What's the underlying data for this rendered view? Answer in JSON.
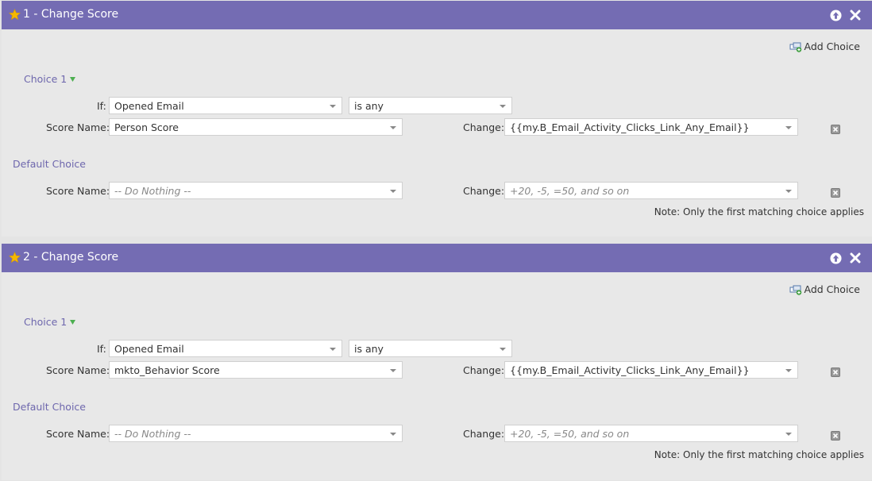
{
  "steps": [
    {
      "title": "1 - Change Score",
      "add_choice": "Add Choice",
      "choice_label": "Choice 1",
      "if_label": "If:",
      "if_value": "Opened Email",
      "operator_value": "is any",
      "score_name_label": "Score Name:",
      "score_name_value": "Person Score",
      "change_label": "Change:",
      "change_value": "{{my.B_Email_Activity_Clicks_Link_Any_Email}}",
      "default_label": "Default Choice",
      "default_score_name_label": "Score Name:",
      "default_score_name_placeholder": "-- Do Nothing --",
      "default_change_label": "Change:",
      "default_change_placeholder": "+20, -5, =50, and so on",
      "note": "Note: Only the first matching choice applies"
    },
    {
      "title": "2 - Change Score",
      "add_choice": "Add Choice",
      "choice_label": "Choice 1",
      "if_label": "If:",
      "if_value": "Opened Email",
      "operator_value": "is any",
      "score_name_label": "Score Name:",
      "score_name_value": "mkto_Behavior Score",
      "change_label": "Change:",
      "change_value": "{{my.B_Email_Activity_Clicks_Link_Any_Email}}",
      "default_label": "Default Choice",
      "default_score_name_label": "Score Name:",
      "default_score_name_placeholder": "-- Do Nothing --",
      "default_change_label": "Change:",
      "default_change_placeholder": "+20, -5, =50, and so on",
      "note": "Note: Only the first matching choice applies"
    }
  ],
  "colors": {
    "header_bg": "#746cb3",
    "accent_text": "#6e67ad",
    "panel_bg": "#e8e8e8",
    "star": "#f5b800"
  },
  "icons": [
    "star-icon",
    "arrow-up-icon",
    "close-icon",
    "add-choice-icon",
    "chevron-down-icon",
    "delete-icon"
  ]
}
